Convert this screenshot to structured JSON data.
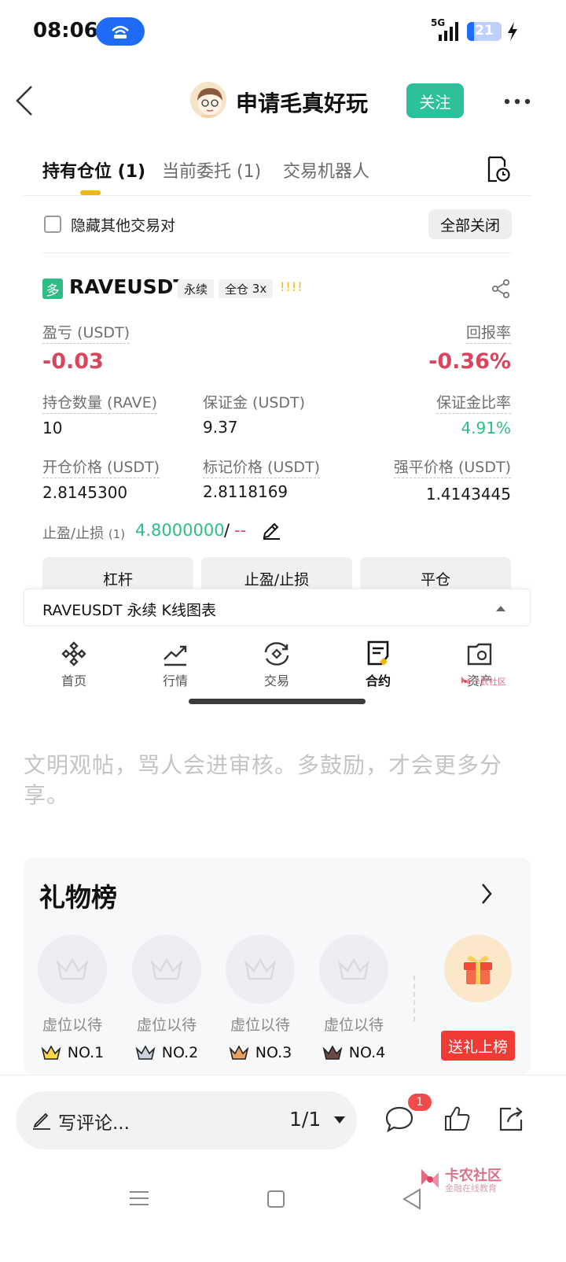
{
  "status_bar": {
    "time": "08:06",
    "network": "5G",
    "battery": "21",
    "battery_level": 0.21,
    "icons": [
      "hotspot-icon",
      "signal-icon",
      "battery-icon",
      "charging-icon"
    ]
  },
  "post_header": {
    "author_name": "申请毛真好玩",
    "follow_label": "关注",
    "accent_color": "#2ec09a"
  },
  "screenshot": {
    "tabs": [
      {
        "label": "持有仓位 (1)",
        "active": true
      },
      {
        "label": "当前委托 (1)",
        "active": false
      },
      {
        "label": "交易机器人",
        "active": false
      }
    ],
    "hide_other_pairs_label": "隐藏其他交易对",
    "close_all_label": "全部关闭",
    "position": {
      "side_badge": "多",
      "symbol": "RAVEUSDT",
      "type_chip": "永续",
      "margin_chip": "全仓",
      "leverage": "3x",
      "risk_bars": "!!!!",
      "pnl_label": "盈亏 (USDT)",
      "pnl_value": "-0.03",
      "roe_label": "回报率",
      "roe_value": "-0.36%",
      "size_label": "持仓数量 (RAVE)",
      "size_value": "10",
      "margin_label": "保证金 (USDT)",
      "margin_value": "9.37",
      "margin_ratio_label": "保证金比率",
      "margin_ratio_value": "4.91%",
      "entry_price_label": "开仓价格 (USDT)",
      "entry_price_value": "2.8145300",
      "mark_price_label": "标记价格 (USDT)",
      "mark_price_value": "2.8118169",
      "liq_price_label": "强平价格 (USDT)",
      "liq_price_value": "1.4143445",
      "tpsl_label": "止盈/止损",
      "tpsl_count": "(1)",
      "tp_value": "4.8000000",
      "tpsl_separator": "/",
      "sl_value": "--"
    },
    "action_buttons": [
      "杠杆",
      "止盈/止损",
      "平仓"
    ],
    "kline_label": "RAVEUSDT 永续 K线图表",
    "bottom_nav": [
      {
        "label": "首页",
        "icon": "home-icon",
        "active": false
      },
      {
        "label": "行情",
        "icon": "markets-icon",
        "active": false
      },
      {
        "label": "交易",
        "icon": "trade-icon",
        "active": false
      },
      {
        "label": "合约",
        "icon": "futures-icon",
        "active": true
      },
      {
        "label": "资产",
        "icon": "wallet-icon",
        "active": false
      }
    ],
    "colors": {
      "up": "#2ebd85",
      "down": "#d9455f",
      "brand": "#f0b90b"
    }
  },
  "post_body": {
    "text": "文明观帖，骂人会进审核。多鼓励，才会更多分享。"
  },
  "gift_list": {
    "title": "礼物榜",
    "slots": [
      {
        "wait": "虚位以待",
        "rank": "NO.1"
      },
      {
        "wait": "虚位以待",
        "rank": "NO.2"
      },
      {
        "wait": "虚位以待",
        "rank": "NO.3"
      },
      {
        "wait": "虚位以待",
        "rank": "NO.4"
      }
    ],
    "send_gift_label": "送礼上榜"
  },
  "comment_bar": {
    "placeholder": "写评论...",
    "page_indicator": "1/1",
    "comment_count_badge": "1"
  },
  "watermark": {
    "title": "卡农社区",
    "subtitle": "金融在线教育"
  }
}
